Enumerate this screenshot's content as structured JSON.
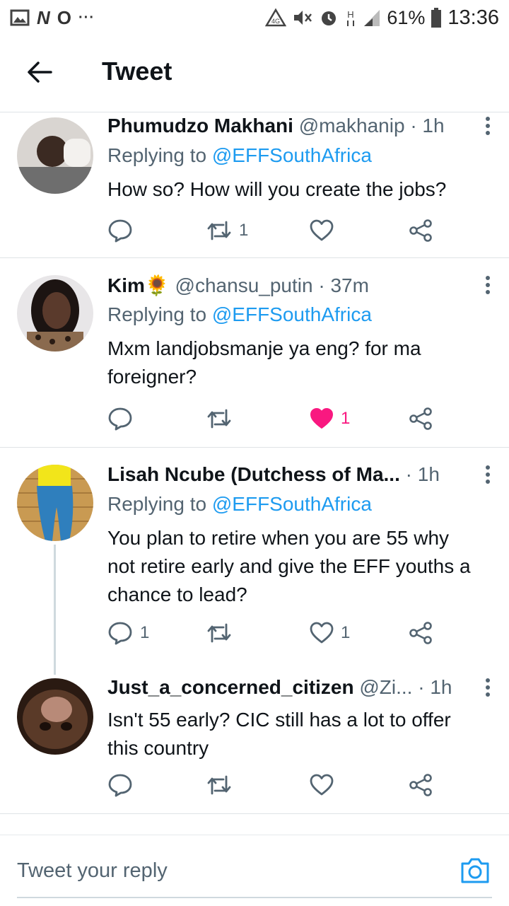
{
  "status_bar": {
    "left_icons": [
      "image-icon",
      "n-icon",
      "o-icon",
      "more-dots-icon"
    ],
    "battery": "61%",
    "time": "13:36"
  },
  "header": {
    "title": "Tweet"
  },
  "colors": {
    "link": "#1d9bf0",
    "secondary": "#536471",
    "like_active": "#f91880"
  },
  "tweets": [
    {
      "name": "Phumudzo Makhani",
      "handle": "@makhanip",
      "time": "· 1h",
      "replying_prefix": "Replying to",
      "replying_to": "@EFFSouthAfrica",
      "text": "How so? How will you create the jobs?",
      "replies": "",
      "retweets": "1",
      "likes": "",
      "liked": false
    },
    {
      "name": "Kim🌻",
      "handle": "@chansu_putin",
      "time": "· 37m",
      "replying_prefix": "Replying to",
      "replying_to": "@EFFSouthAfrica",
      "text": "Mxm landjobsmanje ya eng? for ma foreigner?",
      "replies": "",
      "retweets": "",
      "likes": "1",
      "liked": true
    },
    {
      "name": "Lisah Ncube (Dutchess of Ma...",
      "handle": "",
      "time": "· 1h",
      "replying_prefix": "Replying to",
      "replying_to": "@EFFSouthAfrica",
      "text": "You plan to retire when you are 55 why not retire early and give the EFF youths a chance to lead?",
      "replies": "1",
      "retweets": "",
      "likes": "1",
      "liked": false
    },
    {
      "name": "Just_a_concerned_citizen",
      "handle": "@Zi...",
      "time": "· 1h",
      "text": "Isn't 55 early? CIC still has a lot to offer this country",
      "replies": "",
      "retweets": "",
      "likes": "",
      "liked": false
    }
  ],
  "reply_bar": {
    "placeholder": "Tweet your reply"
  }
}
